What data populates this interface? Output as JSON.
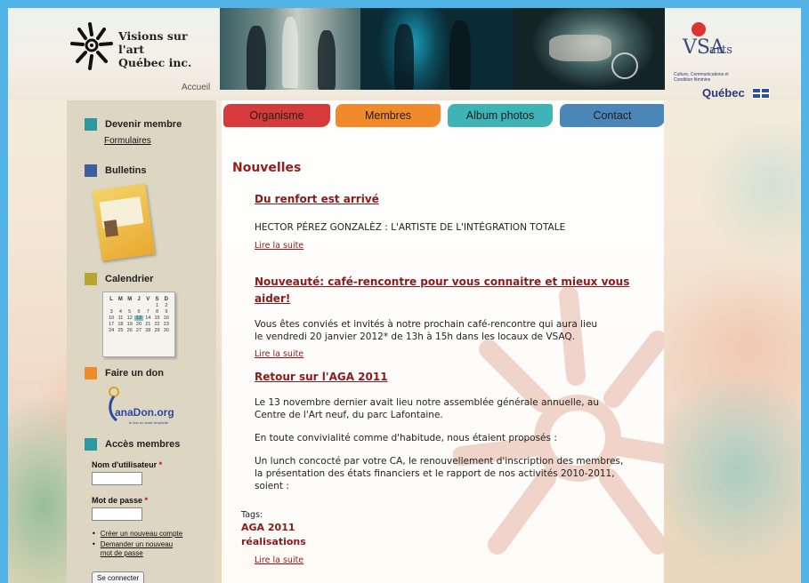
{
  "header": {
    "logo_line1": "Visions sur l'art",
    "logo_line2": "Québec inc.",
    "home_link": "Accueil",
    "partner_vsa": "VSA",
    "partner_arts": "arts",
    "ministry_small": "Culture, Communications et Condition féminine",
    "ministry_big": "Québec"
  },
  "nav": {
    "items": [
      {
        "label": "Organisme",
        "color": "#d73a3a"
      },
      {
        "label": "Membres",
        "color": "#f08a2a"
      },
      {
        "label": "Album photos",
        "color": "#3fb4b6"
      },
      {
        "label": "Contact",
        "color": "#4b86b8"
      }
    ]
  },
  "sidebar": {
    "devenir_membre": "Devenir membre",
    "formulaires": "Formulaires",
    "bulletins": "Bulletins",
    "calendrier": "Calendrier",
    "calendar": {
      "days": [
        "L",
        "M",
        "M",
        "J",
        "V",
        "S",
        "D"
      ],
      "weeks": [
        [
          "",
          "",
          "",
          "",
          "",
          "1",
          "2"
        ],
        [
          "3",
          "4",
          "5",
          "6",
          "7",
          "8",
          "9"
        ],
        [
          "10",
          "11",
          "12",
          "13",
          "14",
          "15",
          "16"
        ],
        [
          "17",
          "18",
          "19",
          "20",
          "21",
          "22",
          "23"
        ],
        [
          "24",
          "25",
          "26",
          "27",
          "28",
          "29",
          "30"
        ]
      ],
      "today": "13"
    },
    "don": "Faire un don",
    "canadon": "anaDon.org",
    "canadon_sub": "le don en toute simplicité",
    "acces": "Accès membres",
    "username_label": "Nom d'utilisateur",
    "password_label": "Mot de passe",
    "required_mark": "*",
    "create_account": "Créer un nouveau compte",
    "request_password_1": "Demander un nouveau",
    "request_password_2": "mot de passe",
    "login_button": "Se connecter",
    "colors": {
      "teal": "#2a9aa0",
      "blue": "#3a5f9a",
      "olive": "#b8a52e",
      "orange": "#ef8a2a"
    }
  },
  "main": {
    "section_title": "Nouvelles",
    "articles": [
      {
        "title": "Du renfort est arrivé",
        "body": "HECTOR PÉREZ GONZALÈZ : L'ARTISTE DE L'INTÉGRATION TOTALE",
        "link": "Lire la suite"
      },
      {
        "title": "Nouveauté: café-rencontre pour vous connaitre et mieux vous aider!",
        "body1": "Vous êtes conviés et invités à notre prochain café-rencontre qui aura lieu",
        "body2": "le vendredi 20 janvier 2012*  de 13h à 15h dans les locaux de VSAQ.",
        "link": "Lire la suite"
      },
      {
        "title": "Retour sur l'AGA 2011",
        "p1a": "Le 13 novembre dernier avait lieu notre assemblée générale annuelle, au",
        "p1b": "Centre de l'Art neuf, du parc Lafontaine.",
        "p2": "En toute convivialité comme d'habitude, nous étaient proposés :",
        "p3a": "Un lunch concocté par votre CA, le renouvellement d'inscription des membres,",
        "p3b": "la présentation des états financiers et le rapport de nos activités 2010-2011,",
        "p3c": "soient :"
      }
    ],
    "tags_label": "Tags:",
    "tags": [
      "AGA 2011",
      "réalisations"
    ],
    "last_link": "Lire la suite"
  }
}
